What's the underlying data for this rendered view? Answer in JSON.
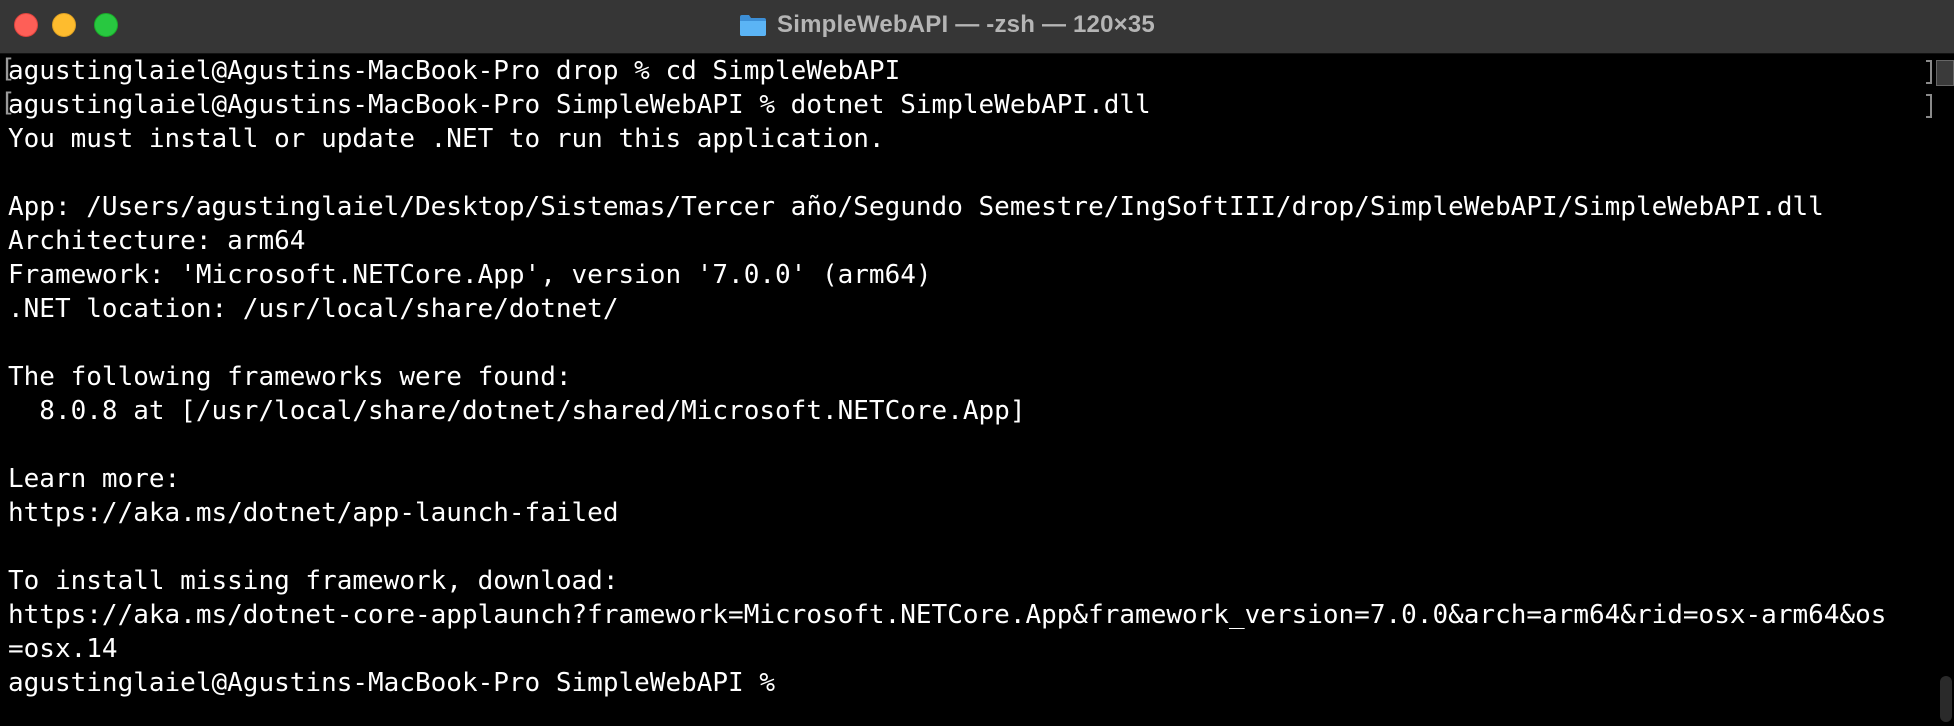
{
  "window": {
    "title": "SimpleWebAPI — -zsh — 120×35",
    "folder_icon": "folder-icon",
    "buttons": {
      "close": "close-button",
      "minimize": "minimize-button",
      "maximize": "maximize-button"
    }
  },
  "terminal": {
    "lines": [
      "agustinglaiel@Agustins-MacBook-Pro drop % cd SimpleWebAPI",
      "agustinglaiel@Agustins-MacBook-Pro SimpleWebAPI % dotnet SimpleWebAPI.dll",
      "You must install or update .NET to run this application.",
      "",
      "App: /Users/agustinglaiel/Desktop/Sistemas/Tercer año/Segundo Semestre/IngSoftIII/drop/SimpleWebAPI/SimpleWebAPI.dll",
      "Architecture: arm64",
      "Framework: 'Microsoft.NETCore.App', version '7.0.0' (arm64)",
      ".NET location: /usr/local/share/dotnet/",
      "",
      "The following frameworks were found:",
      "  8.0.8 at [/usr/local/share/dotnet/shared/Microsoft.NETCore.App]",
      "",
      "Learn more:",
      "https://aka.ms/dotnet/app-launch-failed",
      "",
      "To install missing framework, download:",
      "https://aka.ms/dotnet-core-applaunch?framework=Microsoft.NETCore.App&framework_version=7.0.0&arch=arm64&rid=osx-arm64&os",
      "=osx.14",
      "agustinglaiel@Agustins-MacBook-Pro SimpleWebAPI % "
    ]
  },
  "colors": {
    "background": "#000000",
    "text": "#ffffff",
    "titlebar": "#363636",
    "title_text": "#b5b5b5",
    "close": "#fe5f57",
    "minimize": "#febc2e",
    "maximize": "#28c840",
    "folder": "#4aa8f0"
  }
}
